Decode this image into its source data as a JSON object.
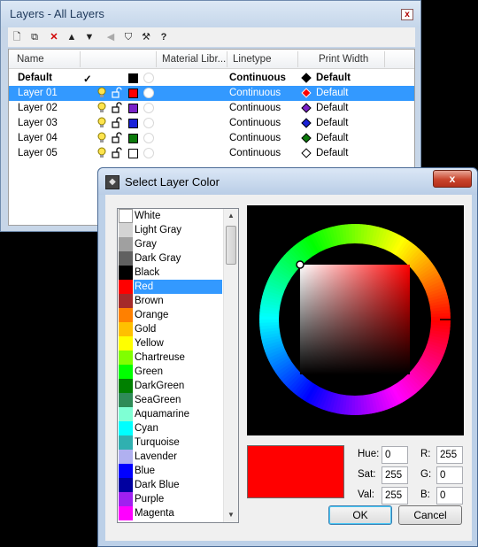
{
  "layers_window": {
    "title": "Layers - All Layers",
    "close_label": "x",
    "toolbar": {
      "new": "🗋",
      "new_sublayer": "⧉",
      "delete": "✕",
      "up": "▲",
      "down": "▼",
      "back": "◀",
      "filter": "⛉",
      "tools": "⚒",
      "help": "?"
    },
    "columns": [
      "Name",
      "Material Libr...",
      "Linetype",
      "Print Width"
    ],
    "rows": [
      {
        "name": "Default",
        "current": "✓",
        "color": "#000000",
        "linetype": "Continuous",
        "print_color": "#000000",
        "print_width": "Default",
        "selected": false,
        "bold": true
      },
      {
        "name": "Layer 01",
        "current": "",
        "color": "#ff0000",
        "linetype": "Continuous",
        "print_color": "#ff0000",
        "print_width": "Default",
        "selected": true,
        "bold": false
      },
      {
        "name": "Layer 02",
        "current": "",
        "color": "#7a22c8",
        "linetype": "Continuous",
        "print_color": "#7a22c8",
        "print_width": "Default",
        "selected": false,
        "bold": false
      },
      {
        "name": "Layer 03",
        "current": "",
        "color": "#1a22d8",
        "linetype": "Continuous",
        "print_color": "#1a22d8",
        "print_width": "Default",
        "selected": false,
        "bold": false
      },
      {
        "name": "Layer 04",
        "current": "",
        "color": "#0b7a0b",
        "linetype": "Continuous",
        "print_color": "#0b7a0b",
        "print_width": "Default",
        "selected": false,
        "bold": false
      },
      {
        "name": "Layer 05",
        "current": "",
        "color": "#ffffff",
        "linetype": "Continuous",
        "print_color": "#ffffff",
        "print_width": "Default",
        "selected": false,
        "bold": false
      }
    ]
  },
  "color_dialog": {
    "title": "Select Layer Color",
    "close_label": "x",
    "colors": [
      {
        "name": "White",
        "hex": "#ffffff"
      },
      {
        "name": "Light Gray",
        "hex": "#d3d3d3"
      },
      {
        "name": "Gray",
        "hex": "#a0a0a0"
      },
      {
        "name": "Dark Gray",
        "hex": "#606060"
      },
      {
        "name": "Black",
        "hex": "#000000"
      },
      {
        "name": "Red",
        "hex": "#ff0000",
        "selected": true
      },
      {
        "name": "Brown",
        "hex": "#a52a2a"
      },
      {
        "name": "Orange",
        "hex": "#ff8000"
      },
      {
        "name": "Gold",
        "hex": "#ffc000"
      },
      {
        "name": "Yellow",
        "hex": "#ffff00"
      },
      {
        "name": "Chartreuse",
        "hex": "#80ff00"
      },
      {
        "name": "Green",
        "hex": "#00ff00"
      },
      {
        "name": "DarkGreen",
        "hex": "#008000"
      },
      {
        "name": "SeaGreen",
        "hex": "#2e8b57"
      },
      {
        "name": "Aquamarine",
        "hex": "#7fffd4"
      },
      {
        "name": "Cyan",
        "hex": "#00ffff"
      },
      {
        "name": "Turquoise",
        "hex": "#30b0b0"
      },
      {
        "name": "Lavender",
        "hex": "#b0b0f0"
      },
      {
        "name": "Blue",
        "hex": "#0000ff"
      },
      {
        "name": "Dark Blue",
        "hex": "#0000a0"
      },
      {
        "name": "Purple",
        "hex": "#a020f0"
      },
      {
        "name": "Magenta",
        "hex": "#ff00ff"
      }
    ],
    "current_color": "#ff0000",
    "hue_label": "Hue:",
    "hue": "0",
    "sat_label": "Sat:",
    "sat": "255",
    "val_label": "Val:",
    "val": "255",
    "r_label": "R:",
    "r": "255",
    "g_label": "G:",
    "g": "0",
    "b_label": "B:",
    "b": "0",
    "ok_label": "OK",
    "cancel_label": "Cancel"
  }
}
